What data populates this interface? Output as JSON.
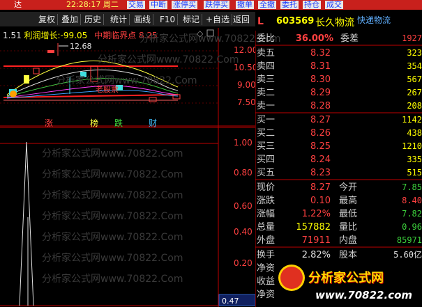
{
  "topbar": {
    "items": [
      "达",
      "22:28:17 周二",
      "交易",
      "中断",
      "涨停买",
      "跌停买",
      "撤单",
      "全撤",
      "委托",
      "持仓",
      "成交"
    ]
  },
  "toolbar": {
    "buttons": [
      "复权",
      "叠加",
      "历史",
      "统计",
      "画线",
      "F10",
      "标记",
      "+自选",
      "返回"
    ]
  },
  "stock": {
    "marker": "L",
    "code": "603569",
    "name": "长久物流",
    "link": "快递物流"
  },
  "indicator": {
    "prefix": "1.51",
    "label": "利润增长:",
    "value": "-99.05",
    "extra_label": "中期临界点",
    "extra_value": "8.25",
    "high_label": "12.68",
    "annotation": "老股票"
  },
  "upper_axis": [
    "12.00",
    "10.50",
    "9.00",
    "7.50"
  ],
  "lower_axis": [
    "1.00",
    "0.80",
    "0.60",
    "0.40",
    "0.20",
    "0.47"
  ],
  "signals": [
    "涨",
    "榜",
    "跌",
    "财"
  ],
  "quote": {
    "weibi_label": "委比",
    "weibi": "36.00%",
    "weicha_label": "委差",
    "weicha": "1927",
    "asks": [
      {
        "label": "卖五",
        "price": "8.32",
        "vol": "323"
      },
      {
        "label": "卖四",
        "price": "8.31",
        "vol": "354"
      },
      {
        "label": "卖三",
        "price": "8.30",
        "vol": "567"
      },
      {
        "label": "卖二",
        "price": "8.29",
        "vol": "267"
      },
      {
        "label": "卖一",
        "price": "8.28",
        "vol": "208"
      }
    ],
    "bids": [
      {
        "label": "买一",
        "price": "8.27",
        "vol": "1142"
      },
      {
        "label": "买二",
        "price": "8.26",
        "vol": "438"
      },
      {
        "label": "买三",
        "price": "8.25",
        "vol": "1210"
      },
      {
        "label": "买四",
        "price": "8.24",
        "vol": "335"
      },
      {
        "label": "买五",
        "price": "8.23",
        "vol": "515"
      }
    ],
    "stats": [
      {
        "l1": "现价",
        "v1": "8.27",
        "l2": "今开",
        "v2": "7.85",
        "c1": "red",
        "c2": "green"
      },
      {
        "l1": "涨跌",
        "v1": "0.10",
        "l2": "最高",
        "v2": "8.40",
        "c1": "red",
        "c2": "red"
      },
      {
        "l1": "涨幅",
        "v1": "1.22%",
        "l2": "最低",
        "v2": "7.82",
        "c1": "red",
        "c2": "green"
      },
      {
        "l1": "总量",
        "v1": "157882",
        "l2": "量比",
        "v2": "0.96",
        "c1": "yellow",
        "c2": "green"
      },
      {
        "l1": "外盘",
        "v1": "71911",
        "l2": "内盘",
        "v2": "85971",
        "c1": "red",
        "c2": "green"
      }
    ],
    "extra": [
      {
        "l1": "换手",
        "v1": "2.82%",
        "l2": "股本",
        "v2": "5.60亿"
      },
      {
        "l1": "净资",
        "v1": "",
        "l2": "",
        "v2": ""
      },
      {
        "l1": "收益",
        "v1": "",
        "l2": "",
        "v2": ""
      },
      {
        "l1": "净资",
        "v1": "",
        "l2": "",
        "v2": ""
      }
    ]
  },
  "logo": {
    "title": "分析家公式网",
    "url": "www.70822.com"
  },
  "watermark": "分析家公式网www.70822.Com"
}
